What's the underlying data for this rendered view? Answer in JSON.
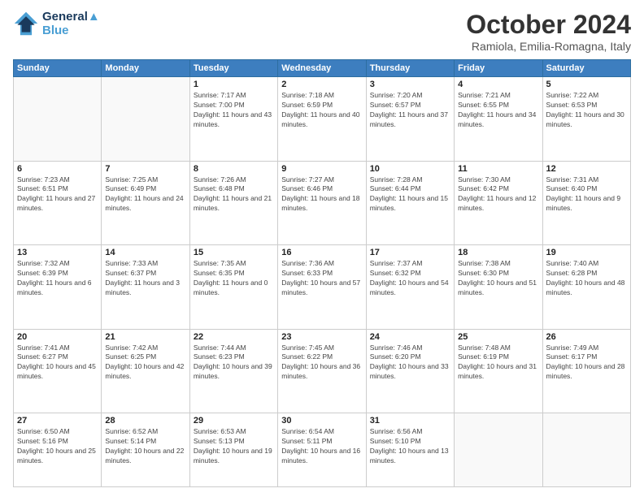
{
  "header": {
    "logo_line1": "General",
    "logo_line2": "Blue",
    "month": "October 2024",
    "location": "Ramiola, Emilia-Romagna, Italy"
  },
  "days_of_week": [
    "Sunday",
    "Monday",
    "Tuesday",
    "Wednesday",
    "Thursday",
    "Friday",
    "Saturday"
  ],
  "weeks": [
    [
      {
        "day": "",
        "detail": ""
      },
      {
        "day": "",
        "detail": ""
      },
      {
        "day": "1",
        "detail": "Sunrise: 7:17 AM\nSunset: 7:00 PM\nDaylight: 11 hours and 43 minutes."
      },
      {
        "day": "2",
        "detail": "Sunrise: 7:18 AM\nSunset: 6:59 PM\nDaylight: 11 hours and 40 minutes."
      },
      {
        "day": "3",
        "detail": "Sunrise: 7:20 AM\nSunset: 6:57 PM\nDaylight: 11 hours and 37 minutes."
      },
      {
        "day": "4",
        "detail": "Sunrise: 7:21 AM\nSunset: 6:55 PM\nDaylight: 11 hours and 34 minutes."
      },
      {
        "day": "5",
        "detail": "Sunrise: 7:22 AM\nSunset: 6:53 PM\nDaylight: 11 hours and 30 minutes."
      }
    ],
    [
      {
        "day": "6",
        "detail": "Sunrise: 7:23 AM\nSunset: 6:51 PM\nDaylight: 11 hours and 27 minutes."
      },
      {
        "day": "7",
        "detail": "Sunrise: 7:25 AM\nSunset: 6:49 PM\nDaylight: 11 hours and 24 minutes."
      },
      {
        "day": "8",
        "detail": "Sunrise: 7:26 AM\nSunset: 6:48 PM\nDaylight: 11 hours and 21 minutes."
      },
      {
        "day": "9",
        "detail": "Sunrise: 7:27 AM\nSunset: 6:46 PM\nDaylight: 11 hours and 18 minutes."
      },
      {
        "day": "10",
        "detail": "Sunrise: 7:28 AM\nSunset: 6:44 PM\nDaylight: 11 hours and 15 minutes."
      },
      {
        "day": "11",
        "detail": "Sunrise: 7:30 AM\nSunset: 6:42 PM\nDaylight: 11 hours and 12 minutes."
      },
      {
        "day": "12",
        "detail": "Sunrise: 7:31 AM\nSunset: 6:40 PM\nDaylight: 11 hours and 9 minutes."
      }
    ],
    [
      {
        "day": "13",
        "detail": "Sunrise: 7:32 AM\nSunset: 6:39 PM\nDaylight: 11 hours and 6 minutes."
      },
      {
        "day": "14",
        "detail": "Sunrise: 7:33 AM\nSunset: 6:37 PM\nDaylight: 11 hours and 3 minutes."
      },
      {
        "day": "15",
        "detail": "Sunrise: 7:35 AM\nSunset: 6:35 PM\nDaylight: 11 hours and 0 minutes."
      },
      {
        "day": "16",
        "detail": "Sunrise: 7:36 AM\nSunset: 6:33 PM\nDaylight: 10 hours and 57 minutes."
      },
      {
        "day": "17",
        "detail": "Sunrise: 7:37 AM\nSunset: 6:32 PM\nDaylight: 10 hours and 54 minutes."
      },
      {
        "day": "18",
        "detail": "Sunrise: 7:38 AM\nSunset: 6:30 PM\nDaylight: 10 hours and 51 minutes."
      },
      {
        "day": "19",
        "detail": "Sunrise: 7:40 AM\nSunset: 6:28 PM\nDaylight: 10 hours and 48 minutes."
      }
    ],
    [
      {
        "day": "20",
        "detail": "Sunrise: 7:41 AM\nSunset: 6:27 PM\nDaylight: 10 hours and 45 minutes."
      },
      {
        "day": "21",
        "detail": "Sunrise: 7:42 AM\nSunset: 6:25 PM\nDaylight: 10 hours and 42 minutes."
      },
      {
        "day": "22",
        "detail": "Sunrise: 7:44 AM\nSunset: 6:23 PM\nDaylight: 10 hours and 39 minutes."
      },
      {
        "day": "23",
        "detail": "Sunrise: 7:45 AM\nSunset: 6:22 PM\nDaylight: 10 hours and 36 minutes."
      },
      {
        "day": "24",
        "detail": "Sunrise: 7:46 AM\nSunset: 6:20 PM\nDaylight: 10 hours and 33 minutes."
      },
      {
        "day": "25",
        "detail": "Sunrise: 7:48 AM\nSunset: 6:19 PM\nDaylight: 10 hours and 31 minutes."
      },
      {
        "day": "26",
        "detail": "Sunrise: 7:49 AM\nSunset: 6:17 PM\nDaylight: 10 hours and 28 minutes."
      }
    ],
    [
      {
        "day": "27",
        "detail": "Sunrise: 6:50 AM\nSunset: 5:16 PM\nDaylight: 10 hours and 25 minutes."
      },
      {
        "day": "28",
        "detail": "Sunrise: 6:52 AM\nSunset: 5:14 PM\nDaylight: 10 hours and 22 minutes."
      },
      {
        "day": "29",
        "detail": "Sunrise: 6:53 AM\nSunset: 5:13 PM\nDaylight: 10 hours and 19 minutes."
      },
      {
        "day": "30",
        "detail": "Sunrise: 6:54 AM\nSunset: 5:11 PM\nDaylight: 10 hours and 16 minutes."
      },
      {
        "day": "31",
        "detail": "Sunrise: 6:56 AM\nSunset: 5:10 PM\nDaylight: 10 hours and 13 minutes."
      },
      {
        "day": "",
        "detail": ""
      },
      {
        "day": "",
        "detail": ""
      }
    ]
  ]
}
